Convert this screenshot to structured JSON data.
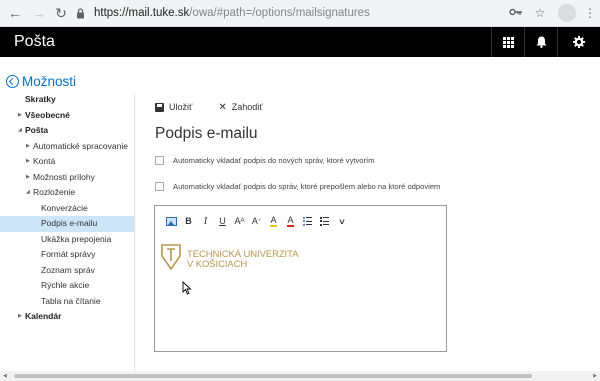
{
  "browser": {
    "url_host": "https://mail.tuke.sk",
    "url_path": "/owa/#path=/options/mailsignatures"
  },
  "app": {
    "title": "Pošta"
  },
  "nav": {
    "back_label": "Možnosti",
    "items": [
      {
        "label": "Skratky",
        "level": 0,
        "bold": true,
        "expandable": false
      },
      {
        "label": "Všeobecné",
        "level": 0,
        "bold": true,
        "expandable": true,
        "expanded": false
      },
      {
        "label": "Pošta",
        "level": 0,
        "bold": true,
        "expandable": true,
        "expanded": true
      },
      {
        "label": "Automatické spracovanie",
        "level": 1,
        "bold": false,
        "expandable": true,
        "expanded": false
      },
      {
        "label": "Kontá",
        "level": 1,
        "bold": false,
        "expandable": true,
        "expanded": false
      },
      {
        "label": "Možnosti prílohy",
        "level": 1,
        "bold": false,
        "expandable": true,
        "expanded": false
      },
      {
        "label": "Rozloženie",
        "level": 1,
        "bold": false,
        "expandable": true,
        "expanded": true
      },
      {
        "label": "Konverzácie",
        "level": 2,
        "bold": false,
        "expandable": false
      },
      {
        "label": "Podpis e-mailu",
        "level": 2,
        "bold": false,
        "expandable": false,
        "selected": true
      },
      {
        "label": "Ukážka prepojenia",
        "level": 2,
        "bold": false,
        "expandable": false
      },
      {
        "label": "Formát správy",
        "level": 2,
        "bold": false,
        "expandable": false
      },
      {
        "label": "Zoznam správ",
        "level": 2,
        "bold": false,
        "expandable": false
      },
      {
        "label": "Rýchle akcie",
        "level": 2,
        "bold": false,
        "expandable": false
      },
      {
        "label": "Tabla na čítanie",
        "level": 2,
        "bold": false,
        "expandable": false
      },
      {
        "label": "Kalendár",
        "level": 0,
        "bold": true,
        "expandable": true,
        "expanded": false
      }
    ]
  },
  "toolbar": {
    "save_label": "Uložiť",
    "discard_label": "Zahodiť"
  },
  "main": {
    "title": "Podpis e-mailu",
    "option_new": "Automaticky vkladať podpis do nových správ, ktoré vytvorím",
    "option_forward": "Automaticky vkladať podpis do správ, ktoré prepošlem alebo na ktoré odpoviem",
    "option_new_checked": false,
    "option_forward_checked": false
  },
  "editor": {
    "bold": "B",
    "italic": "I",
    "underline": "U",
    "font_size": "A",
    "grow": "A",
    "highlight": "A",
    "font_color": "A",
    "signature_line1": "TECHNICKÁ UNIVERZITA",
    "signature_line2": "V KOŠICIACH"
  },
  "colors": {
    "header_bg": "#000000",
    "accent": "#0072c6",
    "selected_bg": "#cde6f7",
    "logo_gold": "#b8964f"
  }
}
